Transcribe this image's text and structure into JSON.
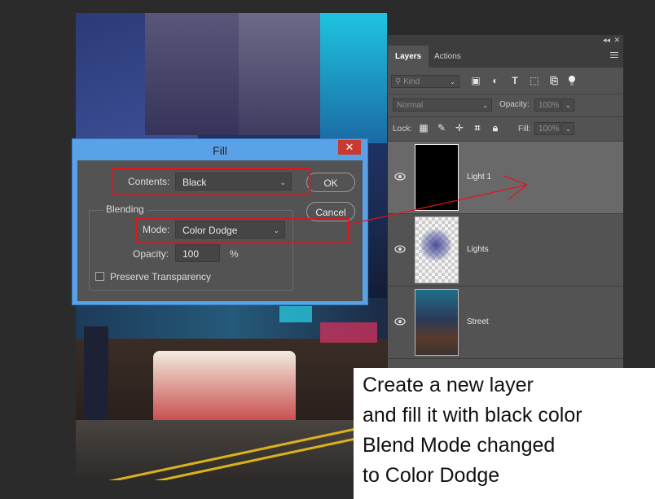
{
  "canvas": {
    "image_name": "hong-kong-street-photo"
  },
  "layers_panel": {
    "tabs": [
      {
        "label": "Layers"
      },
      {
        "label": "Actions"
      }
    ],
    "filter": {
      "placeholder": "Kind"
    },
    "blend_mode": "Normal",
    "opacity_label": "Opacity:",
    "opacity_value": "100%",
    "lock_label": "Lock:",
    "fill_label": "Fill:",
    "fill_value": "100%",
    "layers": [
      {
        "name": "Light 1",
        "selected": true,
        "visible": true
      },
      {
        "name": "Lights",
        "selected": false,
        "visible": true
      },
      {
        "name": "Street",
        "selected": false,
        "visible": true
      }
    ]
  },
  "fill_dialog": {
    "title": "Fill",
    "close_glyph": "✕",
    "contents_label": "Contents:",
    "contents_value": "Black",
    "ok_label": "OK",
    "cancel_label": "Cancel",
    "blending_label": "Blending",
    "mode_label": "Mode:",
    "mode_value": "Color Dodge",
    "opacity_label": "Opacity:",
    "opacity_value": "100",
    "opacity_unit": "%",
    "preserve_transparency_label": "Preserve Transparency",
    "preserve_transparency_checked": false
  },
  "annotation": {
    "lines": [
      "Create a new layer",
      "and fill it with black color",
      "Blend Mode changed",
      "to Color Dodge"
    ],
    "highlight_color": "#e0141e"
  }
}
